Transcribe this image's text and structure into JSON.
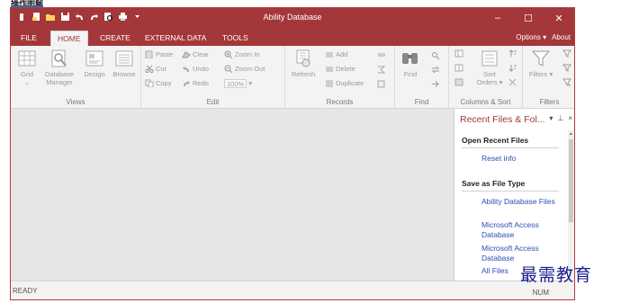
{
  "crop_label": "操作图解",
  "window": {
    "title": "Ability Database",
    "minimize_glyph": "–",
    "maximize_glyph": "☐",
    "close_glyph": "✕"
  },
  "quick_access": [
    "app-icon",
    "new-icon",
    "open-icon",
    "save-icon",
    "undo-icon",
    "redo-icon",
    "print-preview-icon",
    "print-icon",
    "customize-dropdown-icon"
  ],
  "tabs": [
    {
      "label": "FILE"
    },
    {
      "label": "HOME"
    },
    {
      "label": "CREATE"
    },
    {
      "label": "EXTERNAL DATA"
    },
    {
      "label": "TOOLS"
    }
  ],
  "active_tab": "HOME",
  "tabs_right": {
    "options": "Options ▾",
    "about": "About"
  },
  "ribbon": {
    "views": {
      "label": "Views",
      "grid": "Grid",
      "grid_arrow": "⌄",
      "database_manager": "Database\nManager",
      "design": "Design",
      "browse": "Browse"
    },
    "edit": {
      "label": "Edit",
      "paste": "Paste",
      "cut": "Cut",
      "copy": "Copy",
      "clear": "Clear",
      "undo": "Undo",
      "redo": "Redo",
      "zoom_in": "Zoom In",
      "zoom_out": "Zoom Out",
      "zoom_value": "100%"
    },
    "records": {
      "label": "Records",
      "refresh": "Refresh",
      "add": "Add",
      "delete": "Delete",
      "duplicate": "Duplicate"
    },
    "find": {
      "label": "Find",
      "find": "Find"
    },
    "columns_sort": {
      "label": "Columns & Sort",
      "sort_orders": "Sort\nOrders ▾"
    },
    "filters": {
      "label": "Filters",
      "filters": "Filters ▾"
    }
  },
  "side_pane": {
    "title": "Recent Files & Fol...",
    "pin_glyph": "▾",
    "dock_glyph": "⊥",
    "close_glyph": "×",
    "open_recent": {
      "heading": "Open Recent Files",
      "links": [
        "Reset info"
      ]
    },
    "save_as": {
      "heading": "Save as File Type",
      "links": [
        "Ability Database Files",
        "Microsoft Access Database",
        "Microsoft Access Database",
        "All Files"
      ]
    }
  },
  "status": {
    "left": "READY",
    "right": "NUM"
  },
  "watermark": "最需教育",
  "colors": {
    "brand": "#a4373a",
    "link": "#2b4fb5",
    "workspace": "#e6e6e6",
    "ribbon_bg": "#f3f3f3"
  }
}
